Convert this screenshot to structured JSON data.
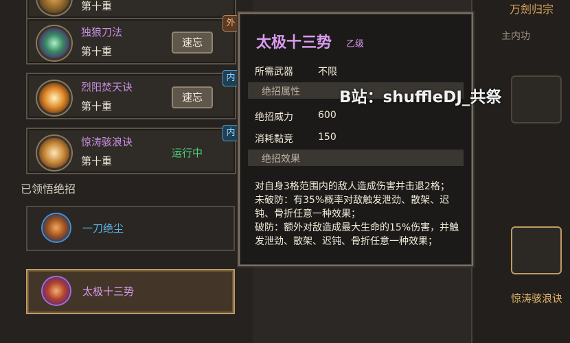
{
  "skill_list": {
    "partial_top": {
      "level": "第十重"
    },
    "cards": [
      {
        "name": "独狼刀法",
        "level": "第十重",
        "action": "速忘",
        "badge": "外",
        "icon": "wolf-claw-icon",
        "color": "#4fbf7d",
        "badge_type": "out"
      },
      {
        "name": "烈阳焚天诀",
        "level": "第十重",
        "action": "速忘",
        "badge": "内",
        "icon": "sun-flame-icon",
        "color": "#e0a44a",
        "badge_type": "in"
      },
      {
        "name": "惊涛骇浪诀",
        "level": "第十重",
        "status": "运行中",
        "badge": "内",
        "icon": "wave-icon",
        "color": "#e0a44a",
        "badge_type": "in"
      }
    ]
  },
  "ultimates": {
    "section_title": "已领悟绝招",
    "items": [
      {
        "name": "一刀绝尘",
        "color": "#5ab6e8",
        "icon": "blade-slash-icon"
      },
      {
        "name": "太极十三势",
        "color": "#d99bf0",
        "icon": "taiji-icon"
      }
    ]
  },
  "tooltip": {
    "title": "太极十三势",
    "grade": "乙级",
    "weapon_label": "所需武器",
    "weapon_value": "不限",
    "attr_header": "绝招属性",
    "power_label": "绝招威力",
    "power_value": "600",
    "cost_label": "消耗黏竞",
    "cost_value": "150",
    "effect_header": "绝招效果",
    "effect_lines": [
      "对自身3格范围内的敌人造成伤害并击退2格；",
      "未破防：有35%概率对敌触发泄劲、散架、迟钝、骨折任意一种效果；",
      "破防：额外对敌造成最大生命的15%伤害，并触发泄劲、散架、迟钝、骨折任意一种效果；"
    ]
  },
  "watermark": "B站：shuffleDJ_共祭",
  "right_panel": {
    "title": "万劍归宗",
    "label_main": "主内功",
    "bottom_label": "惊涛骇浪诀"
  },
  "colors": {
    "purple": "#d99bf0",
    "blue": "#5ab6e8",
    "green_running": "#4fd37a",
    "gold": "#d9a35a"
  }
}
